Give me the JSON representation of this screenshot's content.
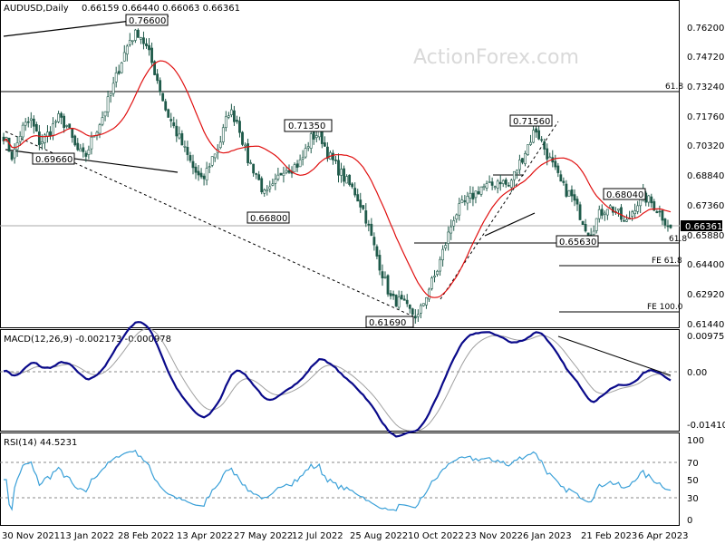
{
  "header": {
    "symbol": "AUDUSD,Daily",
    "ohlc": "0.66159 0.66440 0.66063 0.66361"
  },
  "watermark": "ActionForex.com",
  "colors": {
    "candle": "#1f5a4a",
    "ma": "#e01010",
    "macd": "#0a0a8a",
    "signal": "#a0a0a0",
    "rsi": "#3aa0d8",
    "grid": "#000000"
  },
  "chart_data": [
    {
      "type": "candlestick",
      "title": "AUDUSD,Daily",
      "x_dates": [
        "30 Nov 2021",
        "13 Jan 2022",
        "28 Feb 2022",
        "13 Apr 2022",
        "27 May 2022",
        "12 Jul 2022",
        "25 Aug 2022",
        "10 Oct 2022",
        "23 Nov 2022",
        "6 Jan 2023",
        "21 Feb 2023",
        "6 Apr 2023"
      ],
      "y_ticks": [
        "0.76200",
        "0.74720",
        "0.73240",
        "0.71760",
        "0.70320",
        "0.68840",
        "0.67360",
        "0.65880",
        "0.64400",
        "0.62920",
        "0.61440"
      ],
      "ylim": [
        0.613,
        0.7684
      ],
      "last_price": "0.66361",
      "close_path": [
        0.712,
        0.7,
        0.715,
        0.72,
        0.708,
        0.713,
        0.721,
        0.717,
        0.705,
        0.7,
        0.712,
        0.722,
        0.735,
        0.75,
        0.762,
        0.766,
        0.756,
        0.742,
        0.725,
        0.715,
        0.705,
        0.695,
        0.687,
        0.699,
        0.708,
        0.725,
        0.719,
        0.7,
        0.692,
        0.68,
        0.685,
        0.695,
        0.695,
        0.698,
        0.71,
        0.7135,
        0.702,
        0.695,
        0.688,
        0.682,
        0.672,
        0.655,
        0.64,
        0.626,
        0.625,
        0.62,
        0.6169,
        0.63,
        0.64,
        0.655,
        0.67,
        0.676,
        0.68,
        0.685,
        0.685,
        0.689,
        0.685,
        0.695,
        0.705,
        0.7156,
        0.705,
        0.695,
        0.685,
        0.68,
        0.67,
        0.66,
        0.67,
        0.675,
        0.672,
        0.665,
        0.675,
        0.68,
        0.676,
        0.67,
        0.6636
      ],
      "annotations": [
        {
          "label": "0.76600",
          "value": 0.766
        },
        {
          "label": "0.69660",
          "value": 0.6966
        },
        {
          "label": "0.71350",
          "value": 0.7135
        },
        {
          "label": "0.66800",
          "value": 0.668
        },
        {
          "label": "0.61690",
          "value": 0.6169
        },
        {
          "label": "0.71560",
          "value": 0.7156
        },
        {
          "label": "0.68040",
          "value": 0.6804
        },
        {
          "label": "0.65630",
          "value": 0.6563
        }
      ],
      "levels": [
        {
          "label": "61.8",
          "value": 0.732
        },
        {
          "label": "61.8",
          "value": 0.6563
        },
        {
          "label": "FE 61.8",
          "value": 0.644
        },
        {
          "label": "FE 100.0",
          "value": 0.623
        }
      ]
    },
    {
      "type": "line",
      "title": "MACD(12,26,9) -0.002173 -0.000978",
      "y_ticks": [
        "0.009751",
        "0.00",
        "-0.014107"
      ],
      "ylim": [
        -0.0155,
        0.0108
      ]
    },
    {
      "type": "line",
      "title": "RSI(14) 44.5231",
      "y_ticks": [
        "100",
        "70",
        "50",
        "30",
        "0"
      ],
      "ylim": [
        0,
        100
      ]
    }
  ]
}
